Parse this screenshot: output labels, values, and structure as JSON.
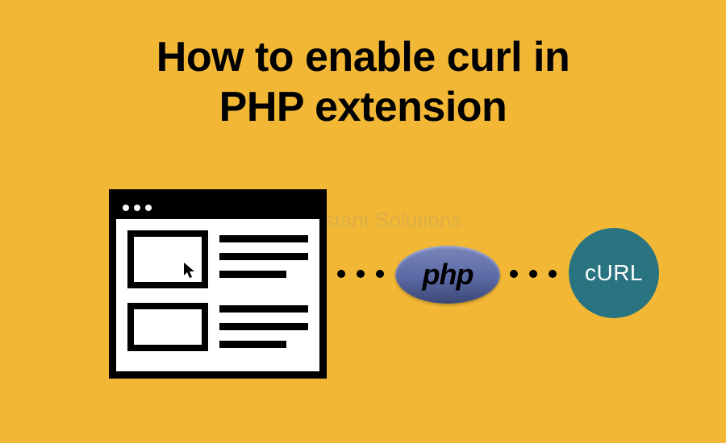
{
  "title_line1": "How to enable curl in",
  "title_line2": "PHP extension",
  "php_label": "php",
  "curl_label": "cURL",
  "watermark": "The Instant Solutions"
}
